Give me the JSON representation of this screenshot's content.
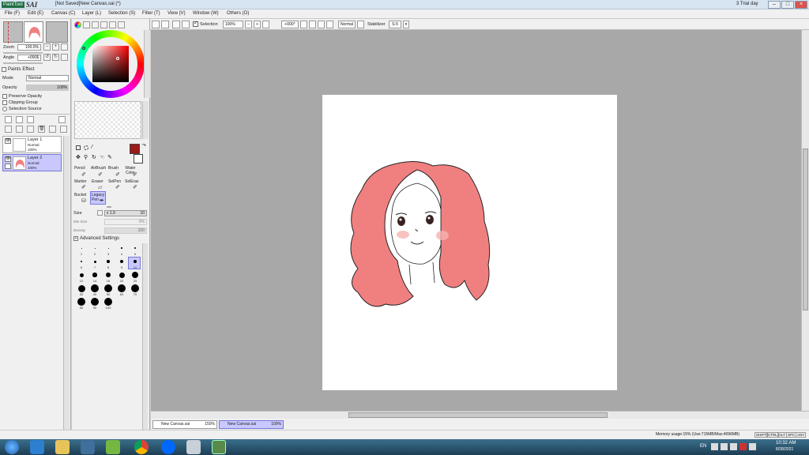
{
  "app": {
    "logo_text": "PaintTool",
    "logo_brand": "SAI",
    "document_title": "[Not Saved]New Canvas.sai (*)",
    "trial": "3 Trial day"
  },
  "menu": [
    "File (F)",
    "Edit (E)",
    "Canvas (C)",
    "Layer (L)",
    "Selection (S)",
    "Filter (T)",
    "View (V)",
    "Window (W)",
    "Others (O)"
  ],
  "toolbar": {
    "selection_label": "Selection",
    "zoom": "100%",
    "angle": "+000°",
    "blend": "Normal",
    "stabilizer_label": "Stabilizer",
    "stabilizer_value": "S-5"
  },
  "navigator": {
    "zoom_label": "Zoom",
    "zoom_value": "100.0%",
    "angle_label": "Angle",
    "angle_value": "+000$"
  },
  "layer_panel": {
    "paints_effect": "Paints Effect",
    "mode_label": "Mode",
    "mode_value": "Normal",
    "opacity_label": "Opacity",
    "opacity_value": "100%",
    "preserve_opacity": "Preserve Opacity",
    "clipping_group": "Clipping Group",
    "selection_source": "Selection Source",
    "layers": [
      {
        "name": "Layer 1",
        "mode": "Normal",
        "opacity": "100%"
      },
      {
        "name": "Layer 2",
        "mode": "Normal",
        "opacity": "100%"
      }
    ]
  },
  "tools": {
    "row1": [
      "Pencil",
      "AirBrush",
      "Brush",
      "Water Color"
    ],
    "row2": [
      "Marker",
      "Eraser",
      "SelPen",
      "SelEras"
    ],
    "row3": [
      "Bucket",
      "Legacy Pen"
    ]
  },
  "brush": {
    "size_label": "Size",
    "size_mult": "x 1.0",
    "size_value": "10",
    "minsize_label": "Min Size",
    "minsize_value": "0%",
    "density_label": "Density",
    "density_value": "100",
    "advanced": "Advanced Settings"
  },
  "brush_sizes": [
    "1",
    "2",
    "3",
    "4",
    "5",
    "6",
    "7",
    "8",
    "9",
    "10",
    "12",
    "14",
    "16",
    "20",
    "25",
    "30",
    "40",
    "50",
    "60",
    "70",
    "80",
    "90",
    "100"
  ],
  "canvas_tabs": [
    {
      "name": "New Canvas.sai",
      "zoom": "150%"
    },
    {
      "name": "New Canvas.sai",
      "zoom": "100%"
    }
  ],
  "status": {
    "memory": "Memory usage:15% (Use:715MB/Max:4096MB)",
    "keys": [
      "SHIFT",
      "CTRL",
      "ALT",
      "SPC",
      "ANY"
    ]
  },
  "taskbar": {
    "lang": "EN",
    "time": "10:32 AM",
    "date": "8/28/2021"
  },
  "colors": {
    "accent_red": "#9b1a1a",
    "hair": "#f08080",
    "layer_select": "#c8c8ff"
  }
}
